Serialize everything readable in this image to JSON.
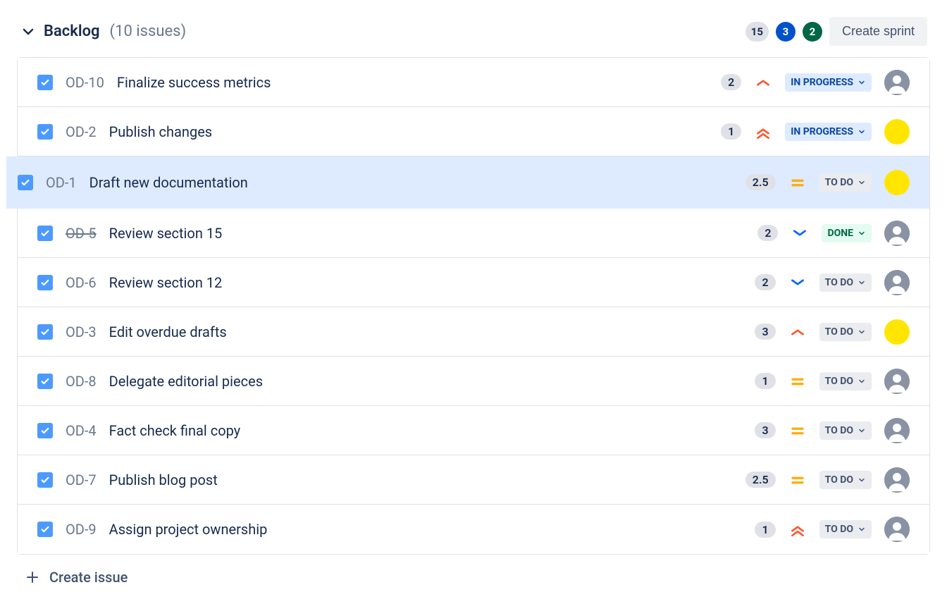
{
  "header": {
    "title": "Backlog",
    "issue_count": "(10 issues)",
    "counts": {
      "grey": "15",
      "blue": "3",
      "green": "2"
    },
    "create_sprint": "Create sprint"
  },
  "statuses": {
    "todo": "TO DO",
    "inprogress": "IN PROGRESS",
    "done": "DONE"
  },
  "issues": [
    {
      "key": "OD-10",
      "summary": "Finalize success metrics",
      "estimate": "2",
      "priority": "high",
      "status": "inprogress",
      "assignee": "unassigned",
      "strike": false,
      "selected": false
    },
    {
      "key": "OD-2",
      "summary": "Publish changes",
      "estimate": "1",
      "priority": "highest",
      "status": "inprogress",
      "assignee": "yellow",
      "strike": false,
      "selected": false
    },
    {
      "key": "OD-1",
      "summary": "Draft new documentation",
      "estimate": "2.5",
      "priority": "medium",
      "status": "todo",
      "assignee": "yellow",
      "strike": false,
      "selected": true
    },
    {
      "key": "OD-5",
      "summary": "Review section 15",
      "estimate": "2",
      "priority": "low",
      "status": "done",
      "assignee": "unassigned",
      "strike": true,
      "selected": false
    },
    {
      "key": "OD-6",
      "summary": "Review section 12",
      "estimate": "2",
      "priority": "low",
      "status": "todo",
      "assignee": "unassigned",
      "strike": false,
      "selected": false
    },
    {
      "key": "OD-3",
      "summary": "Edit overdue drafts",
      "estimate": "3",
      "priority": "high",
      "status": "todo",
      "assignee": "yellow",
      "strike": false,
      "selected": false
    },
    {
      "key": "OD-8",
      "summary": "Delegate editorial pieces",
      "estimate": "1",
      "priority": "medium",
      "status": "todo",
      "assignee": "unassigned",
      "strike": false,
      "selected": false
    },
    {
      "key": "OD-4",
      "summary": "Fact check final copy",
      "estimate": "3",
      "priority": "medium",
      "status": "todo",
      "assignee": "unassigned",
      "strike": false,
      "selected": false
    },
    {
      "key": "OD-7",
      "summary": "Publish blog post",
      "estimate": "2.5",
      "priority": "medium",
      "status": "todo",
      "assignee": "unassigned",
      "strike": false,
      "selected": false
    },
    {
      "key": "OD-9",
      "summary": "Assign project ownership",
      "estimate": "1",
      "priority": "highest",
      "status": "todo",
      "assignee": "unassigned",
      "strike": false,
      "selected": false
    }
  ],
  "create_issue": "Create issue"
}
